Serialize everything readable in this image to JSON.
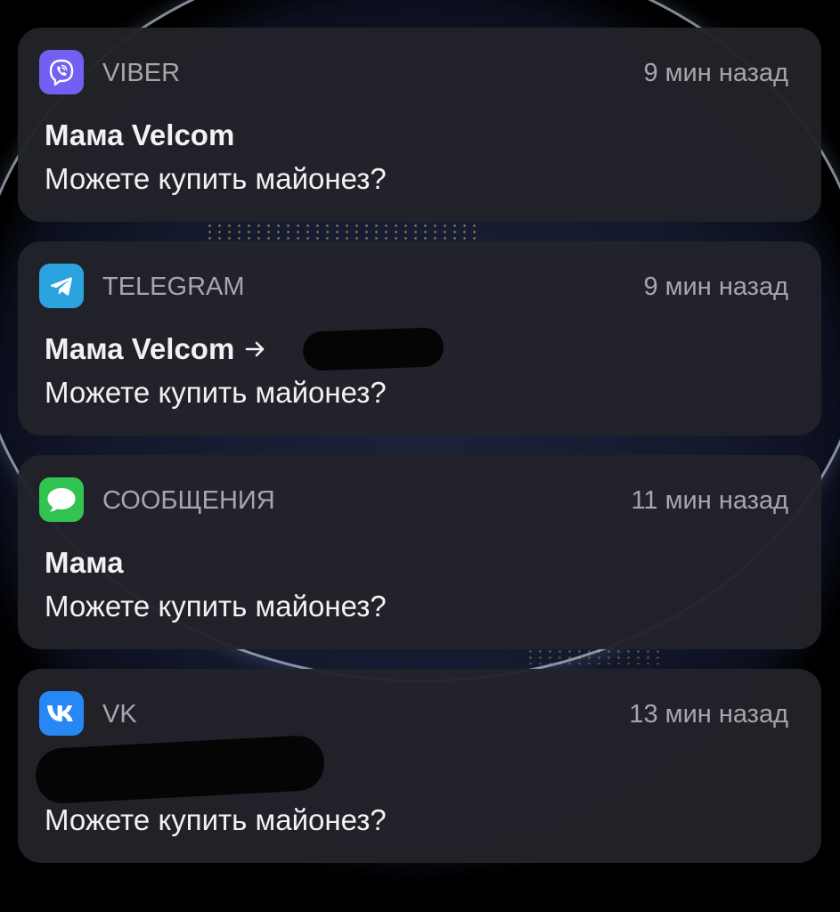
{
  "notifications": [
    {
      "app": "VIBER",
      "time": "9 мин назад",
      "title": "Мама Velcom",
      "message": "Можете купить майонез?",
      "icon": "viber-icon",
      "icon_color": "#7360f2"
    },
    {
      "app": "TELEGRAM",
      "time": "9 мин назад",
      "title": "Мама Velcom",
      "title_suffix_icon": "arrow-right-icon",
      "recipient_redacted": true,
      "message": "Можете купить майонез?",
      "icon": "telegram-icon",
      "icon_color": "#2aa3df"
    },
    {
      "app": "СООБЩЕНИЯ",
      "time": "11 мин назад",
      "title": "Мама",
      "message": "Можете купить майонез?",
      "icon": "messages-icon",
      "icon_color": "#31c451"
    },
    {
      "app": "VK",
      "time": "13 мин назад",
      "title_redacted": true,
      "message": "Можете купить майонез?",
      "icon": "vk-icon",
      "icon_color": "#2787f5"
    }
  ]
}
